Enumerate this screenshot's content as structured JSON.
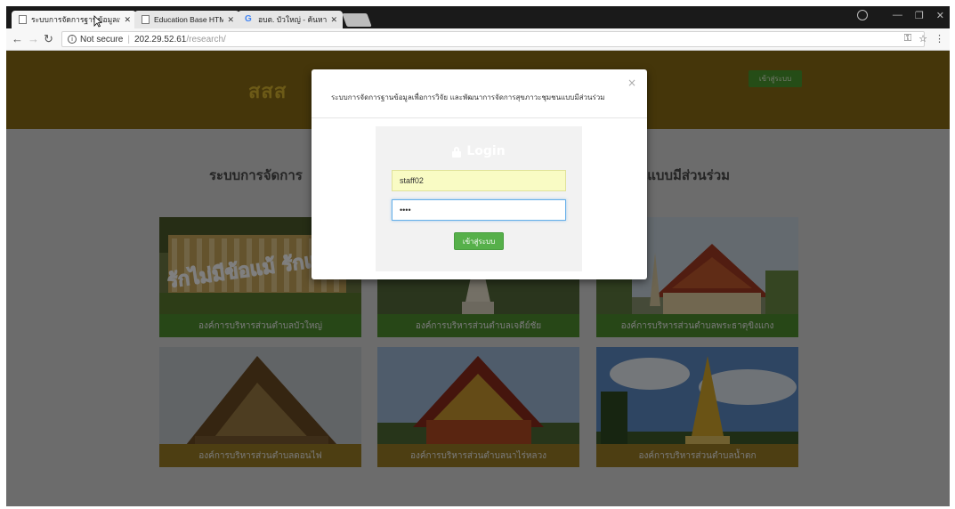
{
  "browser": {
    "tabs": [
      {
        "title": "ระบบการจัดการฐานข้อมูลเพื่อการวิจัย",
        "active": true
      },
      {
        "title": "Education Base HTML Te",
        "active": false
      },
      {
        "title": "อบต. บัวใหญ่ - ค้นหาด้วย G",
        "active": false
      }
    ],
    "security_label": "Not secure",
    "url_host": "202.29.52.61",
    "url_path": "/research/"
  },
  "header": {
    "logo_text": "สสส",
    "login_button": "เข้าสู่ระบบ"
  },
  "page": {
    "heading_left": "ระบบการจัดการ",
    "heading_right": "นแบบมีส่วนร่วม",
    "cards": [
      {
        "label": "องค์การบริหารส่วนตำบลบัวใหญ่",
        "banner": "รักไม่มีข้อแม้ รักแท้ที่"
      },
      {
        "label": "องค์การบริหารส่วนตำบลเจดีย์ชัย"
      },
      {
        "label": "องค์การบริหารส่วนตำบลพระธาตุขิงแกง"
      },
      {
        "label": "องค์การบริหารส่วนตำบลดอนไฟ"
      },
      {
        "label": "องค์การบริหารส่วนตำบลนาไร่หลวง"
      },
      {
        "label": "องค์การบริหารส่วนตำบลน้ำตก"
      }
    ]
  },
  "modal": {
    "title": "ระบบการจัดการฐานข้อมูลเพื่อการวิจัย และพัฒนาการจัดการสุขภาวะชุมชนแบบมีส่วนร่วม",
    "close": "×",
    "login_heading": "Login",
    "username_value": "staff02",
    "password_value": "••••",
    "submit": "เข้าสู่ระบบ"
  },
  "colors": {
    "header_bg": "#8a6d14",
    "card_label_green": "#4f8f2e",
    "card_label_gold": "#9a7c24",
    "submit_green": "#56b04a"
  }
}
